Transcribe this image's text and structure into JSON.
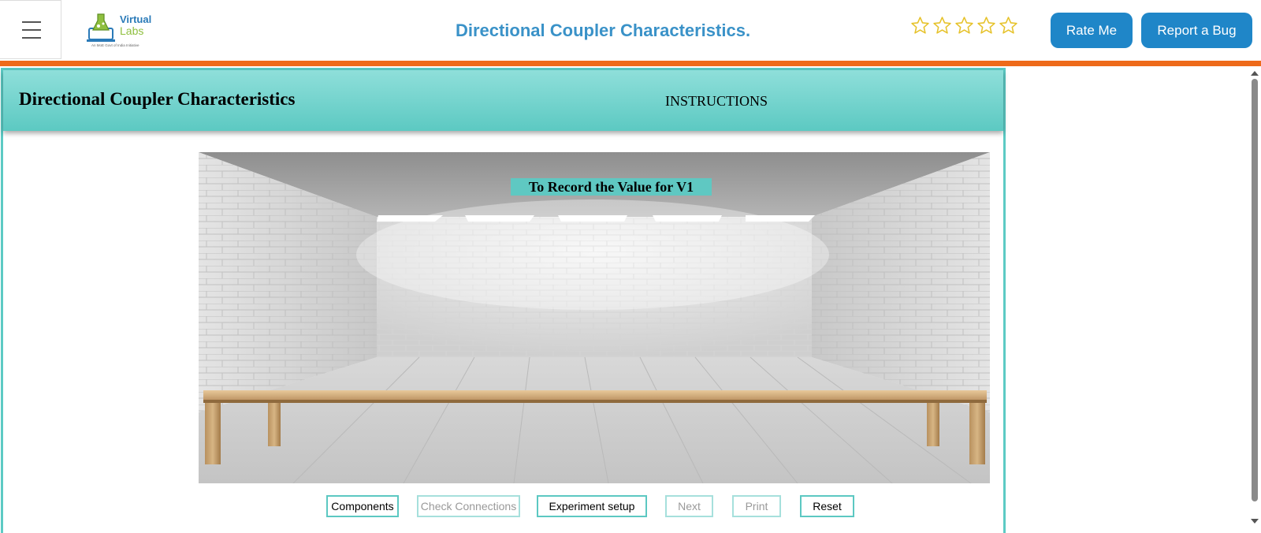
{
  "header": {
    "logo_name": "Virtual",
    "logo_sub": "Labs",
    "logo_tagline": "An MoE Govt of India Initiative",
    "title": "Directional Coupler Characteristics.",
    "rating": {
      "filled": 0,
      "total": 5
    },
    "rate_label": "Rate Me",
    "bug_label": "Report a Bug"
  },
  "lab": {
    "title": "Directional Coupler Characteristics",
    "instructions_label": "INSTRUCTIONS",
    "scene_label": "To Record the Value for V1"
  },
  "controls": [
    {
      "label": "Components",
      "enabled": true
    },
    {
      "label": "Check Connections",
      "enabled": false
    },
    {
      "label": "Experiment setup",
      "enabled": true
    },
    {
      "label": "Next",
      "enabled": false
    },
    {
      "label": "Print",
      "enabled": false
    },
    {
      "label": "Reset",
      "enabled": true
    }
  ],
  "colors": {
    "accent_blue": "#1f86c8",
    "title_blue": "#3a92c8",
    "orange_bar": "#ee6a1a",
    "teal": "#5cc9c2",
    "star": "#e6c22a"
  }
}
